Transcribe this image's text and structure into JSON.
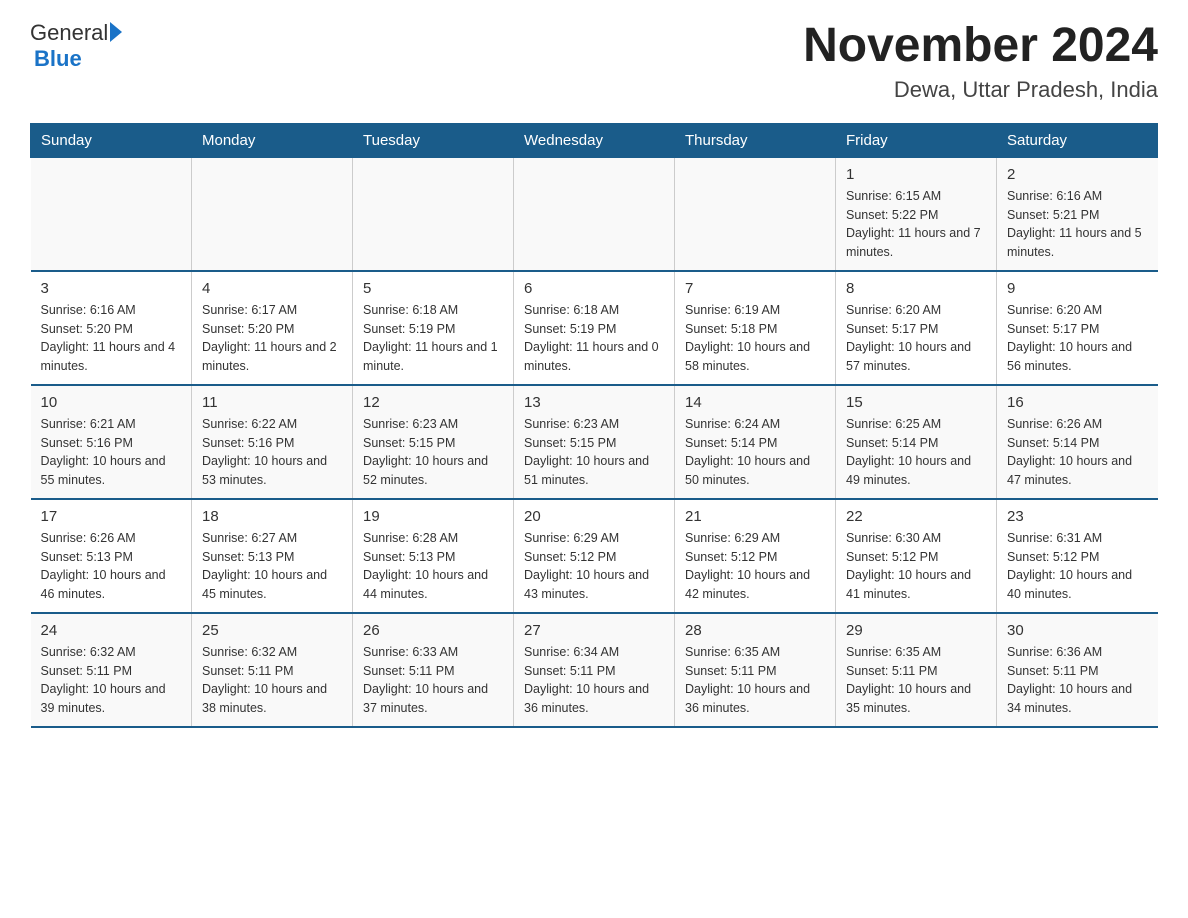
{
  "header": {
    "logo_general": "General",
    "logo_blue": "Blue",
    "title": "November 2024",
    "subtitle": "Dewa, Uttar Pradesh, India"
  },
  "days_of_week": [
    "Sunday",
    "Monday",
    "Tuesday",
    "Wednesday",
    "Thursday",
    "Friday",
    "Saturday"
  ],
  "weeks": [
    [
      {
        "day": "",
        "sunrise": "",
        "sunset": "",
        "daylight": ""
      },
      {
        "day": "",
        "sunrise": "",
        "sunset": "",
        "daylight": ""
      },
      {
        "day": "",
        "sunrise": "",
        "sunset": "",
        "daylight": ""
      },
      {
        "day": "",
        "sunrise": "",
        "sunset": "",
        "daylight": ""
      },
      {
        "day": "",
        "sunrise": "",
        "sunset": "",
        "daylight": ""
      },
      {
        "day": "1",
        "sunrise": "Sunrise: 6:15 AM",
        "sunset": "Sunset: 5:22 PM",
        "daylight": "Daylight: 11 hours and 7 minutes."
      },
      {
        "day": "2",
        "sunrise": "Sunrise: 6:16 AM",
        "sunset": "Sunset: 5:21 PM",
        "daylight": "Daylight: 11 hours and 5 minutes."
      }
    ],
    [
      {
        "day": "3",
        "sunrise": "Sunrise: 6:16 AM",
        "sunset": "Sunset: 5:20 PM",
        "daylight": "Daylight: 11 hours and 4 minutes."
      },
      {
        "day": "4",
        "sunrise": "Sunrise: 6:17 AM",
        "sunset": "Sunset: 5:20 PM",
        "daylight": "Daylight: 11 hours and 2 minutes."
      },
      {
        "day": "5",
        "sunrise": "Sunrise: 6:18 AM",
        "sunset": "Sunset: 5:19 PM",
        "daylight": "Daylight: 11 hours and 1 minute."
      },
      {
        "day": "6",
        "sunrise": "Sunrise: 6:18 AM",
        "sunset": "Sunset: 5:19 PM",
        "daylight": "Daylight: 11 hours and 0 minutes."
      },
      {
        "day": "7",
        "sunrise": "Sunrise: 6:19 AM",
        "sunset": "Sunset: 5:18 PM",
        "daylight": "Daylight: 10 hours and 58 minutes."
      },
      {
        "day": "8",
        "sunrise": "Sunrise: 6:20 AM",
        "sunset": "Sunset: 5:17 PM",
        "daylight": "Daylight: 10 hours and 57 minutes."
      },
      {
        "day": "9",
        "sunrise": "Sunrise: 6:20 AM",
        "sunset": "Sunset: 5:17 PM",
        "daylight": "Daylight: 10 hours and 56 minutes."
      }
    ],
    [
      {
        "day": "10",
        "sunrise": "Sunrise: 6:21 AM",
        "sunset": "Sunset: 5:16 PM",
        "daylight": "Daylight: 10 hours and 55 minutes."
      },
      {
        "day": "11",
        "sunrise": "Sunrise: 6:22 AM",
        "sunset": "Sunset: 5:16 PM",
        "daylight": "Daylight: 10 hours and 53 minutes."
      },
      {
        "day": "12",
        "sunrise": "Sunrise: 6:23 AM",
        "sunset": "Sunset: 5:15 PM",
        "daylight": "Daylight: 10 hours and 52 minutes."
      },
      {
        "day": "13",
        "sunrise": "Sunrise: 6:23 AM",
        "sunset": "Sunset: 5:15 PM",
        "daylight": "Daylight: 10 hours and 51 minutes."
      },
      {
        "day": "14",
        "sunrise": "Sunrise: 6:24 AM",
        "sunset": "Sunset: 5:14 PM",
        "daylight": "Daylight: 10 hours and 50 minutes."
      },
      {
        "day": "15",
        "sunrise": "Sunrise: 6:25 AM",
        "sunset": "Sunset: 5:14 PM",
        "daylight": "Daylight: 10 hours and 49 minutes."
      },
      {
        "day": "16",
        "sunrise": "Sunrise: 6:26 AM",
        "sunset": "Sunset: 5:14 PM",
        "daylight": "Daylight: 10 hours and 47 minutes."
      }
    ],
    [
      {
        "day": "17",
        "sunrise": "Sunrise: 6:26 AM",
        "sunset": "Sunset: 5:13 PM",
        "daylight": "Daylight: 10 hours and 46 minutes."
      },
      {
        "day": "18",
        "sunrise": "Sunrise: 6:27 AM",
        "sunset": "Sunset: 5:13 PM",
        "daylight": "Daylight: 10 hours and 45 minutes."
      },
      {
        "day": "19",
        "sunrise": "Sunrise: 6:28 AM",
        "sunset": "Sunset: 5:13 PM",
        "daylight": "Daylight: 10 hours and 44 minutes."
      },
      {
        "day": "20",
        "sunrise": "Sunrise: 6:29 AM",
        "sunset": "Sunset: 5:12 PM",
        "daylight": "Daylight: 10 hours and 43 minutes."
      },
      {
        "day": "21",
        "sunrise": "Sunrise: 6:29 AM",
        "sunset": "Sunset: 5:12 PM",
        "daylight": "Daylight: 10 hours and 42 minutes."
      },
      {
        "day": "22",
        "sunrise": "Sunrise: 6:30 AM",
        "sunset": "Sunset: 5:12 PM",
        "daylight": "Daylight: 10 hours and 41 minutes."
      },
      {
        "day": "23",
        "sunrise": "Sunrise: 6:31 AM",
        "sunset": "Sunset: 5:12 PM",
        "daylight": "Daylight: 10 hours and 40 minutes."
      }
    ],
    [
      {
        "day": "24",
        "sunrise": "Sunrise: 6:32 AM",
        "sunset": "Sunset: 5:11 PM",
        "daylight": "Daylight: 10 hours and 39 minutes."
      },
      {
        "day": "25",
        "sunrise": "Sunrise: 6:32 AM",
        "sunset": "Sunset: 5:11 PM",
        "daylight": "Daylight: 10 hours and 38 minutes."
      },
      {
        "day": "26",
        "sunrise": "Sunrise: 6:33 AM",
        "sunset": "Sunset: 5:11 PM",
        "daylight": "Daylight: 10 hours and 37 minutes."
      },
      {
        "day": "27",
        "sunrise": "Sunrise: 6:34 AM",
        "sunset": "Sunset: 5:11 PM",
        "daylight": "Daylight: 10 hours and 36 minutes."
      },
      {
        "day": "28",
        "sunrise": "Sunrise: 6:35 AM",
        "sunset": "Sunset: 5:11 PM",
        "daylight": "Daylight: 10 hours and 36 minutes."
      },
      {
        "day": "29",
        "sunrise": "Sunrise: 6:35 AM",
        "sunset": "Sunset: 5:11 PM",
        "daylight": "Daylight: 10 hours and 35 minutes."
      },
      {
        "day": "30",
        "sunrise": "Sunrise: 6:36 AM",
        "sunset": "Sunset: 5:11 PM",
        "daylight": "Daylight: 10 hours and 34 minutes."
      }
    ]
  ]
}
